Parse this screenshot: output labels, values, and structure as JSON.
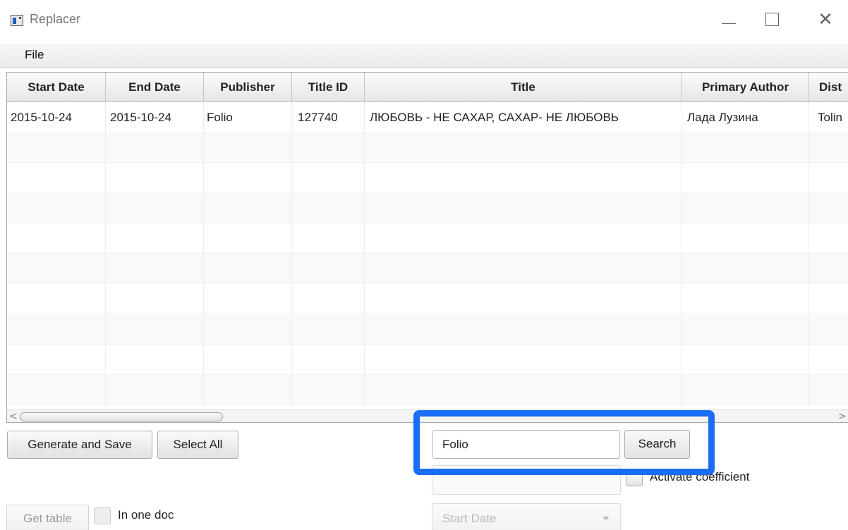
{
  "window": {
    "title": "Replacer",
    "controls": {
      "minimize": "minimize",
      "maximize": "maximize",
      "close": "close"
    }
  },
  "menubar": {
    "items": [
      {
        "label": "File"
      }
    ]
  },
  "table": {
    "columns": [
      {
        "key": "start_date",
        "label": "Start Date"
      },
      {
        "key": "end_date",
        "label": "End Date"
      },
      {
        "key": "publisher",
        "label": "Publisher"
      },
      {
        "key": "title_id",
        "label": "Title ID"
      },
      {
        "key": "title",
        "label": "Title"
      },
      {
        "key": "primary_author",
        "label": "Primary Author"
      },
      {
        "key": "distributor",
        "label": "Dist"
      }
    ],
    "rows": [
      {
        "start_date": "2015-10-24",
        "end_date": "2015-10-24",
        "publisher": "Folio",
        "title_id": "127740",
        "title": "ЛЮБОВЬ - НЕ САХАР, САХАР- НЕ ЛЮБОВЬ",
        "primary_author": "Лада Лузина",
        "distributor": "Tolin"
      }
    ],
    "empty_rows": 9
  },
  "controls": {
    "generate_and_save": "Generate and Save",
    "select_all": "Select All",
    "search_value": "Folio",
    "search_button": "Search",
    "activate_coefficient": "Activate coefficient",
    "get_table": "Get table",
    "in_one_doc": "In one doc",
    "date_select": "Start Date"
  },
  "colors": {
    "highlight": "#1a6ef5"
  }
}
